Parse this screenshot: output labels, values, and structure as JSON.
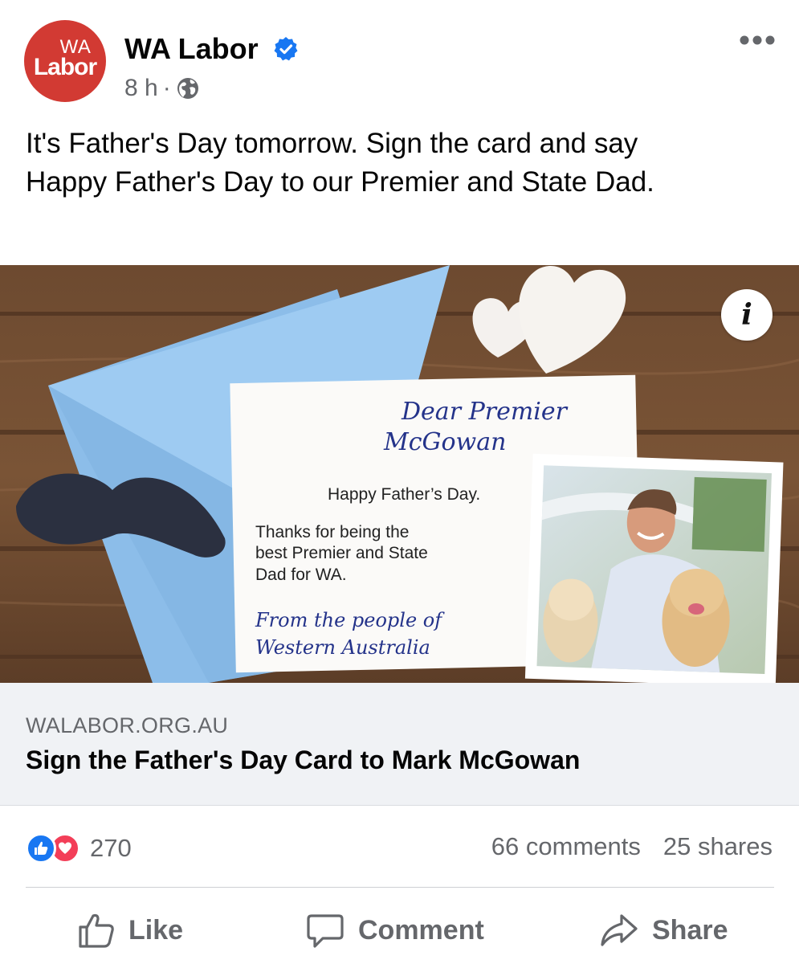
{
  "post": {
    "avatar": {
      "line1": "WA",
      "line2": "Labor"
    },
    "page_name": "WA Labor",
    "time": "8 h",
    "separator": "·",
    "text_lines": [
      "It's Father's Day tomorrow. Sign the card and say",
      "Happy Father's Day to our Premier and State Dad."
    ]
  },
  "image": {
    "card": {
      "salutation_line1": "Dear Premier",
      "salutation_line2": "McGowan",
      "greeting": "Happy Father’s Day.",
      "body_line1": "Thanks for being the",
      "body_line2": "best Premier and State",
      "body_line3": "Dad for WA.",
      "signoff_line1": "From the people of",
      "signoff_line2": "Western Australia"
    },
    "info_label": "i"
  },
  "link": {
    "domain": "WALABOR.ORG.AU",
    "title": "Sign the Father's Day Card to Mark McGowan"
  },
  "stats": {
    "reactions": "270",
    "comments": "66 comments",
    "shares": "25 shares"
  },
  "actions": {
    "like": "Like",
    "comment": "Comment",
    "share": "Share"
  },
  "colors": {
    "brand_red": "#d23a33",
    "facebook_blue": "#1877f2",
    "love_red": "#f33e58",
    "envelope_blue": "#8cbde9"
  }
}
